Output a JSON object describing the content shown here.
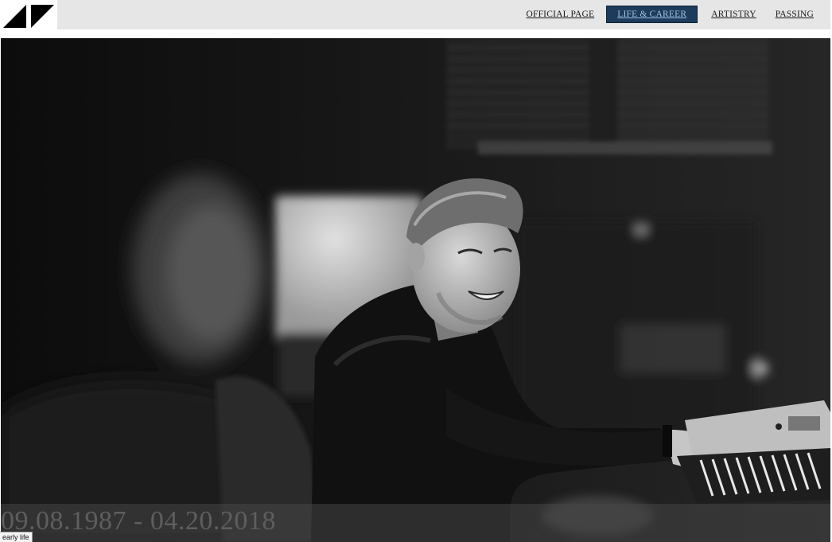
{
  "logo": {
    "icon": "avicii-logo-icon"
  },
  "nav": {
    "items": [
      {
        "label": "OFFICIAL PAGE",
        "active": false
      },
      {
        "label": "LIFE & CAREER",
        "active": true
      },
      {
        "label": "ARTISTRY",
        "active": false
      },
      {
        "label": "PASSING",
        "active": false
      }
    ]
  },
  "hero": {
    "image": "black-and-white-photo-smiling-man-at-keyboard",
    "dates": "09.08.1987 - 04.20.2018"
  },
  "tooltip": {
    "text": "early life"
  },
  "colors": {
    "nav_bg": "#e6e6e6",
    "active_bg": "#1d3b5a",
    "active_text": "#9fc4e6"
  }
}
